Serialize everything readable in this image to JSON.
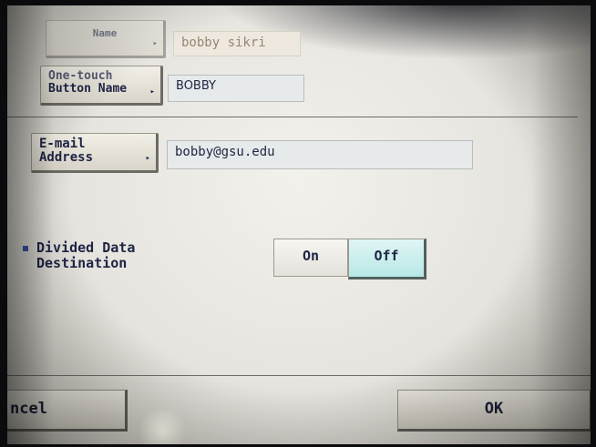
{
  "form": {
    "name": {
      "button_label": "Name",
      "value": "bobby sikri"
    },
    "one_touch": {
      "button_label_line1": "One-touch",
      "button_label_line2": "Button Name",
      "value": "BOBBY"
    },
    "email": {
      "button_label_line1": "E-mail",
      "button_label_line2": "Address",
      "value": "bobby@gsu.edu"
    },
    "divided": {
      "label_line1": "Divided Data",
      "label_line2": "Destination",
      "on_label": "On",
      "off_label": "Off",
      "selected": "Off"
    }
  },
  "footer": {
    "cancel_label": "ncel",
    "ok_label": "OK"
  },
  "icons": {
    "arrow": "triangle-right-icon",
    "bullet": "square-bullet-icon"
  },
  "colors": {
    "selected_segment": "#b8e8e6",
    "bullet": "#3c4fa3"
  }
}
